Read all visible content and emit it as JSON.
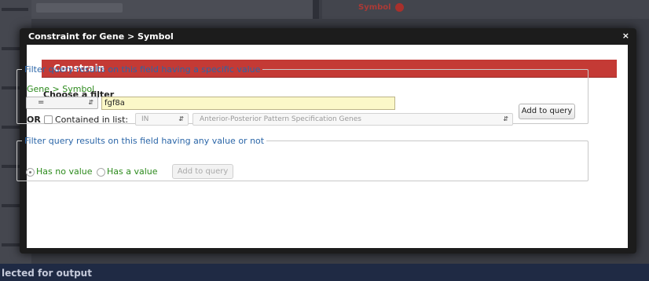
{
  "background": {
    "symbol_label": "Symbol",
    "bottom_text": "lected for output"
  },
  "modal": {
    "title": "Constraint for Gene > Symbol",
    "close": "×",
    "section_title": "Constrain",
    "choose_filter": "Choose a filter",
    "value_filter": {
      "legend": "Filter query results on this field having a specific value",
      "path": "Gene > Symbol",
      "operator": "=",
      "value": "fgf8a",
      "or_label": "OR",
      "contained_label": "Contained in list:",
      "list_operator": "IN",
      "list_name": "Anterior-Posterior Pattern Specification Genes",
      "add_button": "Add to query"
    },
    "null_filter": {
      "legend": "Filter query results on this field having any value or not",
      "option_no_value": "Has no value",
      "option_has_value": "Has a value",
      "add_button": "Add to query"
    }
  },
  "colors": {
    "accent_red": "#c43a35",
    "legend_blue": "#2b66a8",
    "path_green": "#2c8a1c",
    "input_yellow": "#fbf8c8"
  }
}
